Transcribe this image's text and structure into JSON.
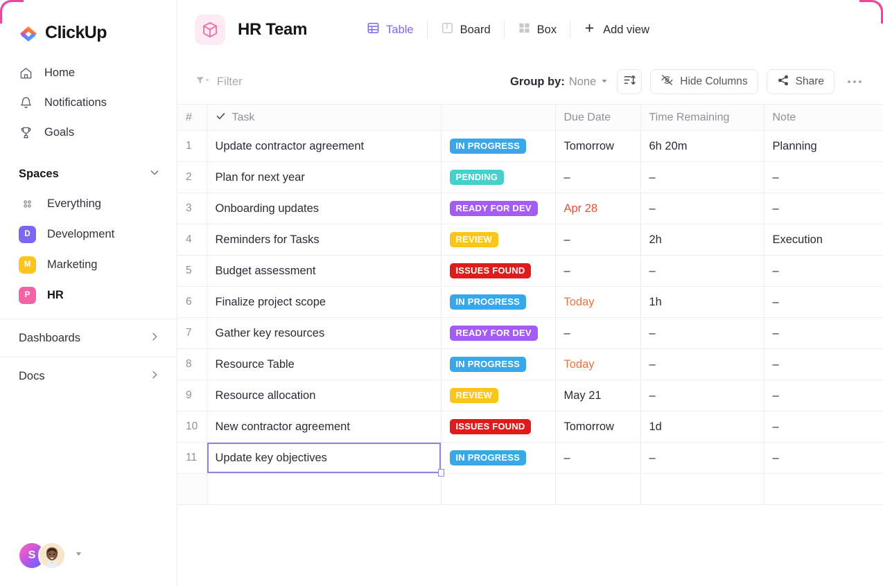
{
  "brand": {
    "name": "ClickUp",
    "logo_icon": "clickup-logo-icon",
    "accent": "#7b68ee",
    "corner_accent": "#ec4899"
  },
  "sidebar": {
    "nav": [
      {
        "label": "Home",
        "icon": "home-icon"
      },
      {
        "label": "Notifications",
        "icon": "bell-icon"
      },
      {
        "label": "Goals",
        "icon": "trophy-icon"
      }
    ],
    "spaces": {
      "title": "Spaces",
      "chevron": "chevron-down-icon",
      "items": [
        {
          "label": "Everything",
          "badge": "",
          "badge_color": "",
          "icon": "four-dots-icon",
          "active": false
        },
        {
          "label": "Development",
          "badge": "D",
          "badge_color": "#7b68ee",
          "icon": "space-badge",
          "active": false
        },
        {
          "label": "Marketing",
          "badge": "M",
          "badge_color": "#fbc51b",
          "icon": "space-badge",
          "active": false
        },
        {
          "label": "HR",
          "badge": "P",
          "badge_color": "#f662a8",
          "icon": "space-badge",
          "active": true
        }
      ]
    },
    "sections": [
      {
        "label": "Dashboards",
        "icon": "chevron-right-icon"
      },
      {
        "label": "Docs",
        "icon": "chevron-right-icon"
      }
    ],
    "footer": {
      "avatar_initial": "S",
      "avatar_name": "avatar-gradient",
      "photo_avatar_name": "avatar-photo",
      "caret": "chevron-down-icon"
    }
  },
  "header": {
    "list_icon": "cube-icon",
    "title": "HR Team",
    "views": [
      {
        "label": "Table",
        "icon": "table-icon",
        "active": true
      },
      {
        "label": "Board",
        "icon": "board-icon",
        "active": false
      },
      {
        "label": "Box",
        "icon": "box-icon",
        "active": false
      }
    ],
    "add_view": {
      "label": "Add view",
      "icon": "plus-icon"
    }
  },
  "toolbar": {
    "filter": {
      "label": "Filter",
      "icon": "funnel-icon"
    },
    "group_by": {
      "label": "Group by:",
      "value": "None",
      "caret": "caret-down-icon"
    },
    "sort_button": {
      "icon": "sort-icon"
    },
    "hide_columns": {
      "label": "Hide Columns",
      "icon": "eye-off-icon"
    },
    "share": {
      "label": "Share",
      "icon": "share-icon"
    },
    "more": {
      "icon": "ellipsis-icon"
    }
  },
  "table": {
    "columns": [
      {
        "key": "num",
        "label": "#"
      },
      {
        "key": "task",
        "label": "Task",
        "icon": "check-icon"
      },
      {
        "key": "status",
        "label": ""
      },
      {
        "key": "due",
        "label": "Due Date"
      },
      {
        "key": "time",
        "label": "Time Remaining"
      },
      {
        "key": "note",
        "label": "Note"
      }
    ],
    "status_colors": {
      "IN PROGRESS": "#3aa8e8",
      "PENDING": "#45d0cc",
      "READY FOR DEV": "#a45cf5",
      "REVIEW": "#fbc51b",
      "ISSUES FOUND": "#e01b1b"
    },
    "rows": [
      {
        "num": "1",
        "task": "Update contractor agreement",
        "status": "IN PROGRESS",
        "due": "Tomorrow",
        "due_style": "normal",
        "time": "6h 20m",
        "note": "Planning"
      },
      {
        "num": "2",
        "task": "Plan for next year",
        "status": "PENDING",
        "due": "–",
        "due_style": "normal",
        "time": "–",
        "note": "–"
      },
      {
        "num": "3",
        "task": "Onboarding updates",
        "status": "READY FOR DEV",
        "due": "Apr 28",
        "due_style": "red",
        "time": "–",
        "note": "–"
      },
      {
        "num": "4",
        "task": "Reminders for Tasks",
        "status": "REVIEW",
        "due": "–",
        "due_style": "normal",
        "time": "2h",
        "note": "Execution"
      },
      {
        "num": "5",
        "task": "Budget assessment",
        "status": "ISSUES FOUND",
        "due": "–",
        "due_style": "normal",
        "time": "–",
        "note": "–"
      },
      {
        "num": "6",
        "task": "Finalize project scope",
        "status": "IN PROGRESS",
        "due": "Today",
        "due_style": "orange",
        "time": "1h",
        "note": "–"
      },
      {
        "num": "7",
        "task": "Gather key resources",
        "status": "READY FOR DEV",
        "due": "–",
        "due_style": "normal",
        "time": "–",
        "note": "–"
      },
      {
        "num": "8",
        "task": "Resource Table",
        "status": "IN PROGRESS",
        "due": "Today",
        "due_style": "orange",
        "time": "–",
        "note": "–"
      },
      {
        "num": "9",
        "task": "Resource allocation",
        "status": "REVIEW",
        "due": "May 21",
        "due_style": "normal",
        "time": "–",
        "note": "–"
      },
      {
        "num": "10",
        "task": "New contractor agreement",
        "status": "ISSUES FOUND",
        "due": "Tomorrow",
        "due_style": "normal",
        "time": "1d",
        "note": "–"
      },
      {
        "num": "11",
        "task": "Update key objectives",
        "status": "IN PROGRESS",
        "due": "–",
        "due_style": "normal",
        "time": "–",
        "note": "–",
        "selected": true
      }
    ]
  }
}
